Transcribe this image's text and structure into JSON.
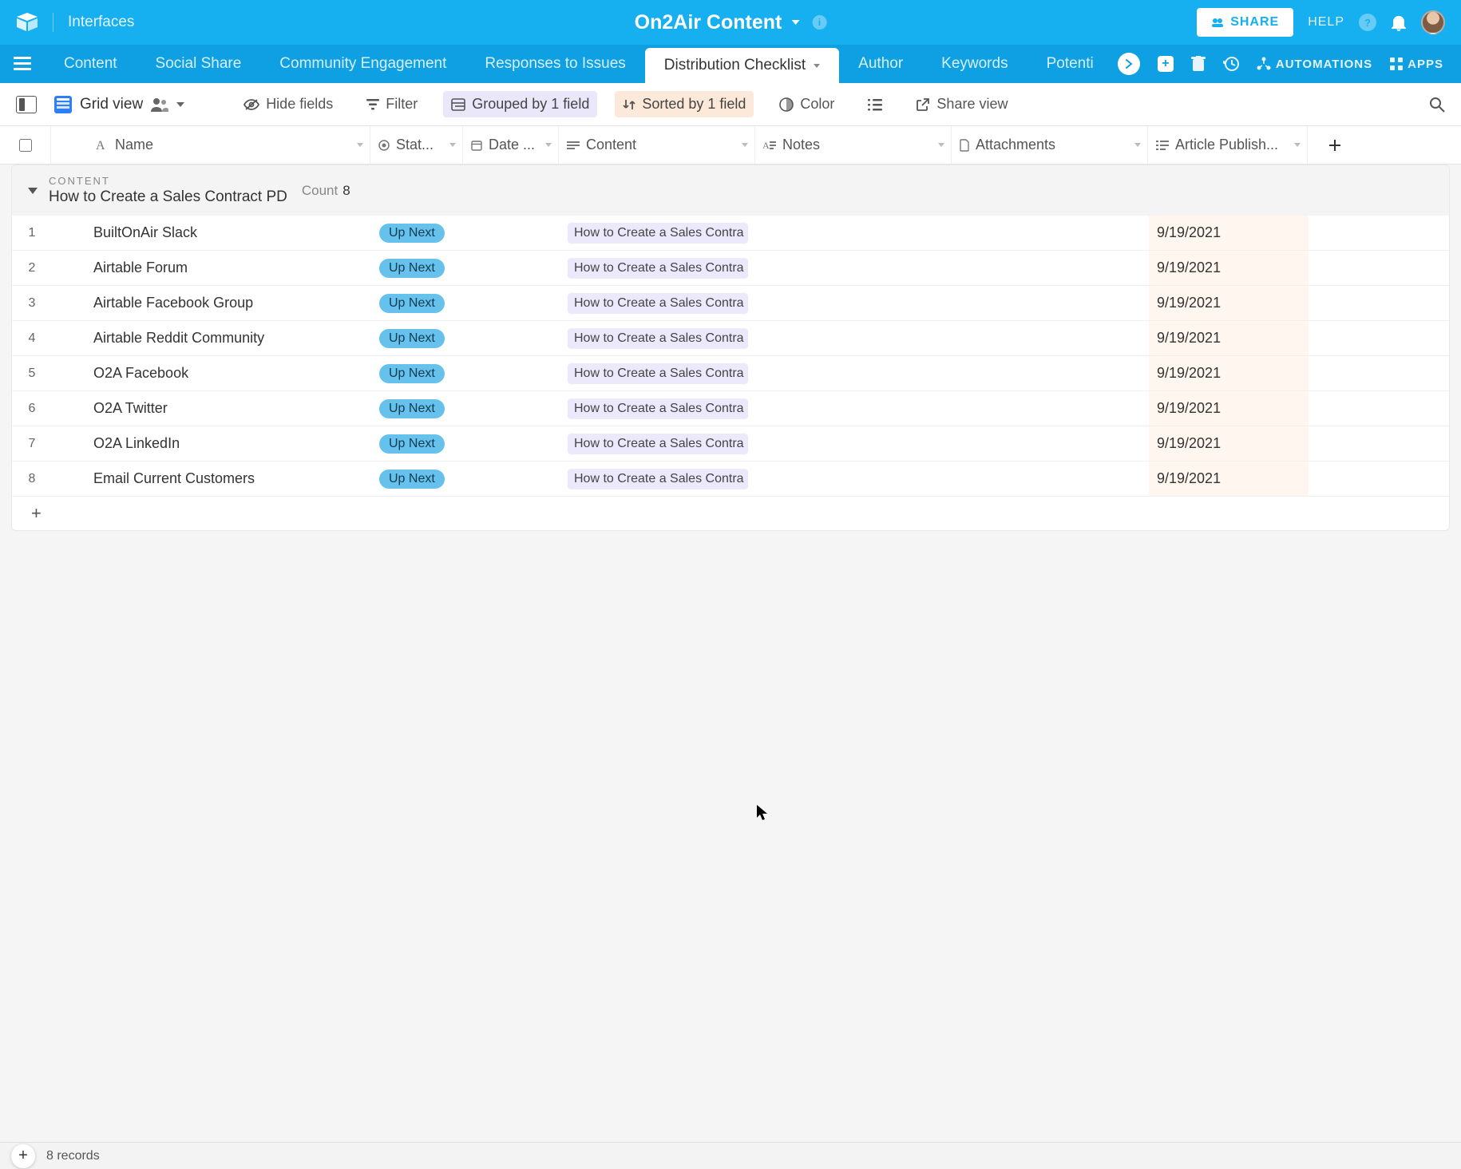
{
  "header": {
    "interfaces_label": "Interfaces",
    "base_title": "On2Air Content",
    "share_label": "SHARE",
    "help_label": "HELP"
  },
  "tabrow": {
    "tabs": [
      {
        "label": "Content",
        "active": false
      },
      {
        "label": "Social Share",
        "active": false
      },
      {
        "label": "Community Engagement",
        "active": false
      },
      {
        "label": "Responses to Issues",
        "active": false
      },
      {
        "label": "Distribution Checklist",
        "active": true
      },
      {
        "label": "Author",
        "active": false
      },
      {
        "label": "Keywords",
        "active": false
      },
      {
        "label": "Potenti",
        "active": false,
        "partial": true
      }
    ],
    "automations_label": "AUTOMATIONS",
    "apps_label": "APPS"
  },
  "toolbar": {
    "view_name": "Grid view",
    "hide_fields": "Hide fields",
    "filter": "Filter",
    "grouped": "Grouped by 1 field",
    "sorted": "Sorted by 1 field",
    "color": "Color",
    "share_view": "Share view"
  },
  "columns": {
    "name": "Name",
    "status": "Stat...",
    "date": "Date ...",
    "content": "Content",
    "notes": "Notes",
    "attachments": "Attachments",
    "article": "Article Publish..."
  },
  "group": {
    "section": "CONTENT",
    "title": "How to Create a Sales Contract PD",
    "count_label": "Count",
    "count_value": "8"
  },
  "rows": [
    {
      "num": "1",
      "name": "BuiltOnAir Slack",
      "status": "Up Next",
      "content": "How to Create a Sales Contra",
      "article": "9/19/2021"
    },
    {
      "num": "2",
      "name": "Airtable Forum",
      "status": "Up Next",
      "content": "How to Create a Sales Contra",
      "article": "9/19/2021"
    },
    {
      "num": "3",
      "name": "Airtable Facebook Group",
      "status": "Up Next",
      "content": "How to Create a Sales Contra",
      "article": "9/19/2021"
    },
    {
      "num": "4",
      "name": "Airtable Reddit Community",
      "status": "Up Next",
      "content": "How to Create a Sales Contra",
      "article": "9/19/2021"
    },
    {
      "num": "5",
      "name": "O2A Facebook",
      "status": "Up Next",
      "content": "How to Create a Sales Contra",
      "article": "9/19/2021"
    },
    {
      "num": "6",
      "name": "O2A Twitter",
      "status": "Up Next",
      "content": "How to Create a Sales Contra",
      "article": "9/19/2021"
    },
    {
      "num": "7",
      "name": "O2A LinkedIn",
      "status": "Up Next",
      "content": "How to Create a Sales Contra",
      "article": "9/19/2021"
    },
    {
      "num": "8",
      "name": "Email Current Customers",
      "status": "Up Next",
      "content": "How to Create a Sales Contra",
      "article": "9/19/2021"
    }
  ],
  "footer": {
    "record_count": "8 records"
  }
}
